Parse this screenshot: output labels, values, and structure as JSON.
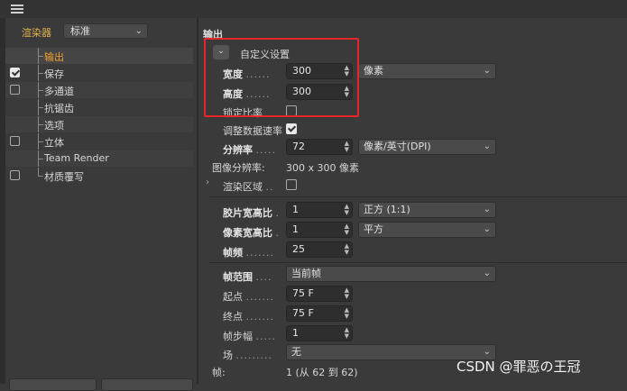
{
  "sidebar": {
    "renderer_label": "渲染器",
    "renderer_value": "标准",
    "items": [
      {
        "label": "输出",
        "checkbox": false,
        "checked": false,
        "selected": true
      },
      {
        "label": "保存",
        "checkbox": true,
        "checked": true,
        "selected": false
      },
      {
        "label": "多通道",
        "checkbox": true,
        "checked": false,
        "selected": false
      },
      {
        "label": "抗锯齿",
        "checkbox": false,
        "checked": false,
        "selected": false
      },
      {
        "label": "选项",
        "checkbox": false,
        "checked": false,
        "selected": false
      },
      {
        "label": "立体",
        "checkbox": true,
        "checked": false,
        "selected": false
      },
      {
        "label": "Team Render",
        "checkbox": false,
        "checked": false,
        "selected": false
      },
      {
        "label": "材质覆写",
        "checkbox": true,
        "checked": false,
        "selected": false
      }
    ]
  },
  "output": {
    "title": "输出",
    "preset_label": "自定义设置",
    "width_label": "宽度",
    "width_value": "300",
    "height_label": "高度",
    "height_value": "300",
    "size_unit": "像素",
    "lock_ratio_label": "锁定比率",
    "adjust_rate_label": "调整数据速率",
    "resolution_label": "分辨率",
    "resolution_value": "72",
    "resolution_unit": "像素/英寸(DPI)",
    "image_res_label": "图像分辨率:",
    "image_res_value": "300 x 300 像素",
    "render_region_label": "渲染区域",
    "film_aspect_label": "胶片宽高比",
    "film_aspect_value": "1",
    "film_aspect_preset": "正方 (1:1)",
    "pixel_aspect_label": "像素宽高比",
    "pixel_aspect_value": "1",
    "pixel_aspect_preset": "平方",
    "fps_label": "帧频",
    "fps_value": "25",
    "frame_range_label": "帧范围",
    "frame_range_value": "当前帧",
    "start_label": "起点",
    "start_value": "75 F",
    "end_label": "终点",
    "end_value": "75 F",
    "frame_step_label": "帧步幅",
    "frame_step_value": "1",
    "field_label": "场",
    "field_value": "无",
    "frames_label": "帧:",
    "frames_value": "1 (从 62 到 62)"
  },
  "watermark": "CSDN @罪恶の王冠",
  "colors": {
    "highlight": "#e8262a",
    "selected_text": "#f0a030"
  }
}
